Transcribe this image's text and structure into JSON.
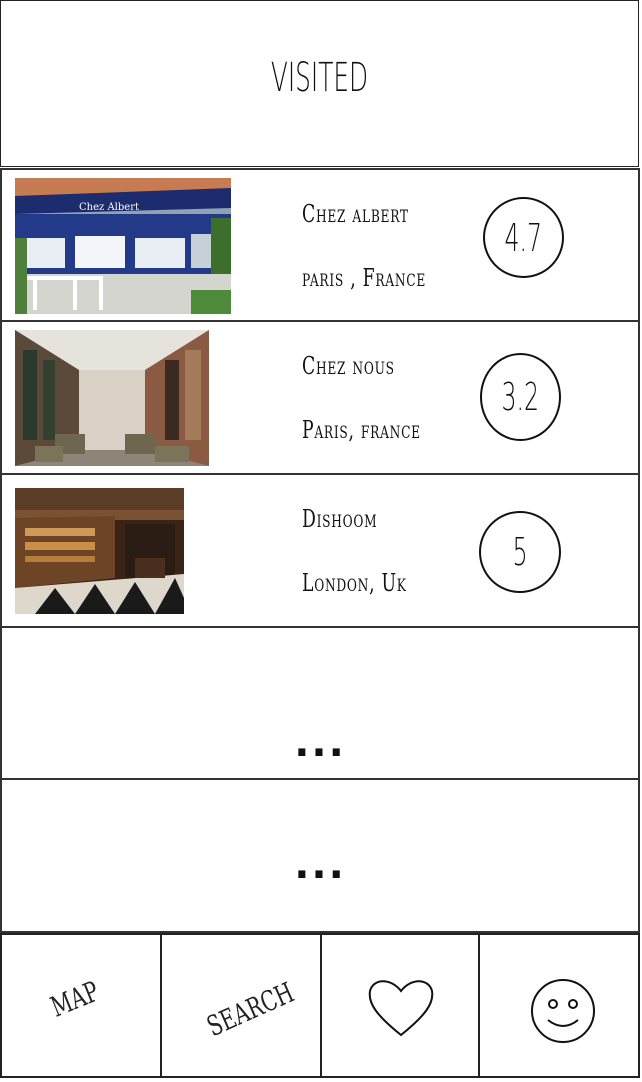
{
  "header": {
    "title": "VISITED"
  },
  "restaurants": [
    {
      "name": "Chez albert",
      "location": "paris , France",
      "rating": "4.7",
      "sign": "Chez Albert"
    },
    {
      "name": "Chez nous",
      "location": "Paris, france",
      "rating": "3.2"
    },
    {
      "name": "Dishoom",
      "location": "London, Uk",
      "rating": "5"
    }
  ],
  "placeholders": [
    "...",
    "..."
  ],
  "nav": {
    "map_label": "MAP",
    "search_label": "SEARCH",
    "favorites_icon": "heart-icon",
    "profile_icon": "smiley-icon"
  }
}
